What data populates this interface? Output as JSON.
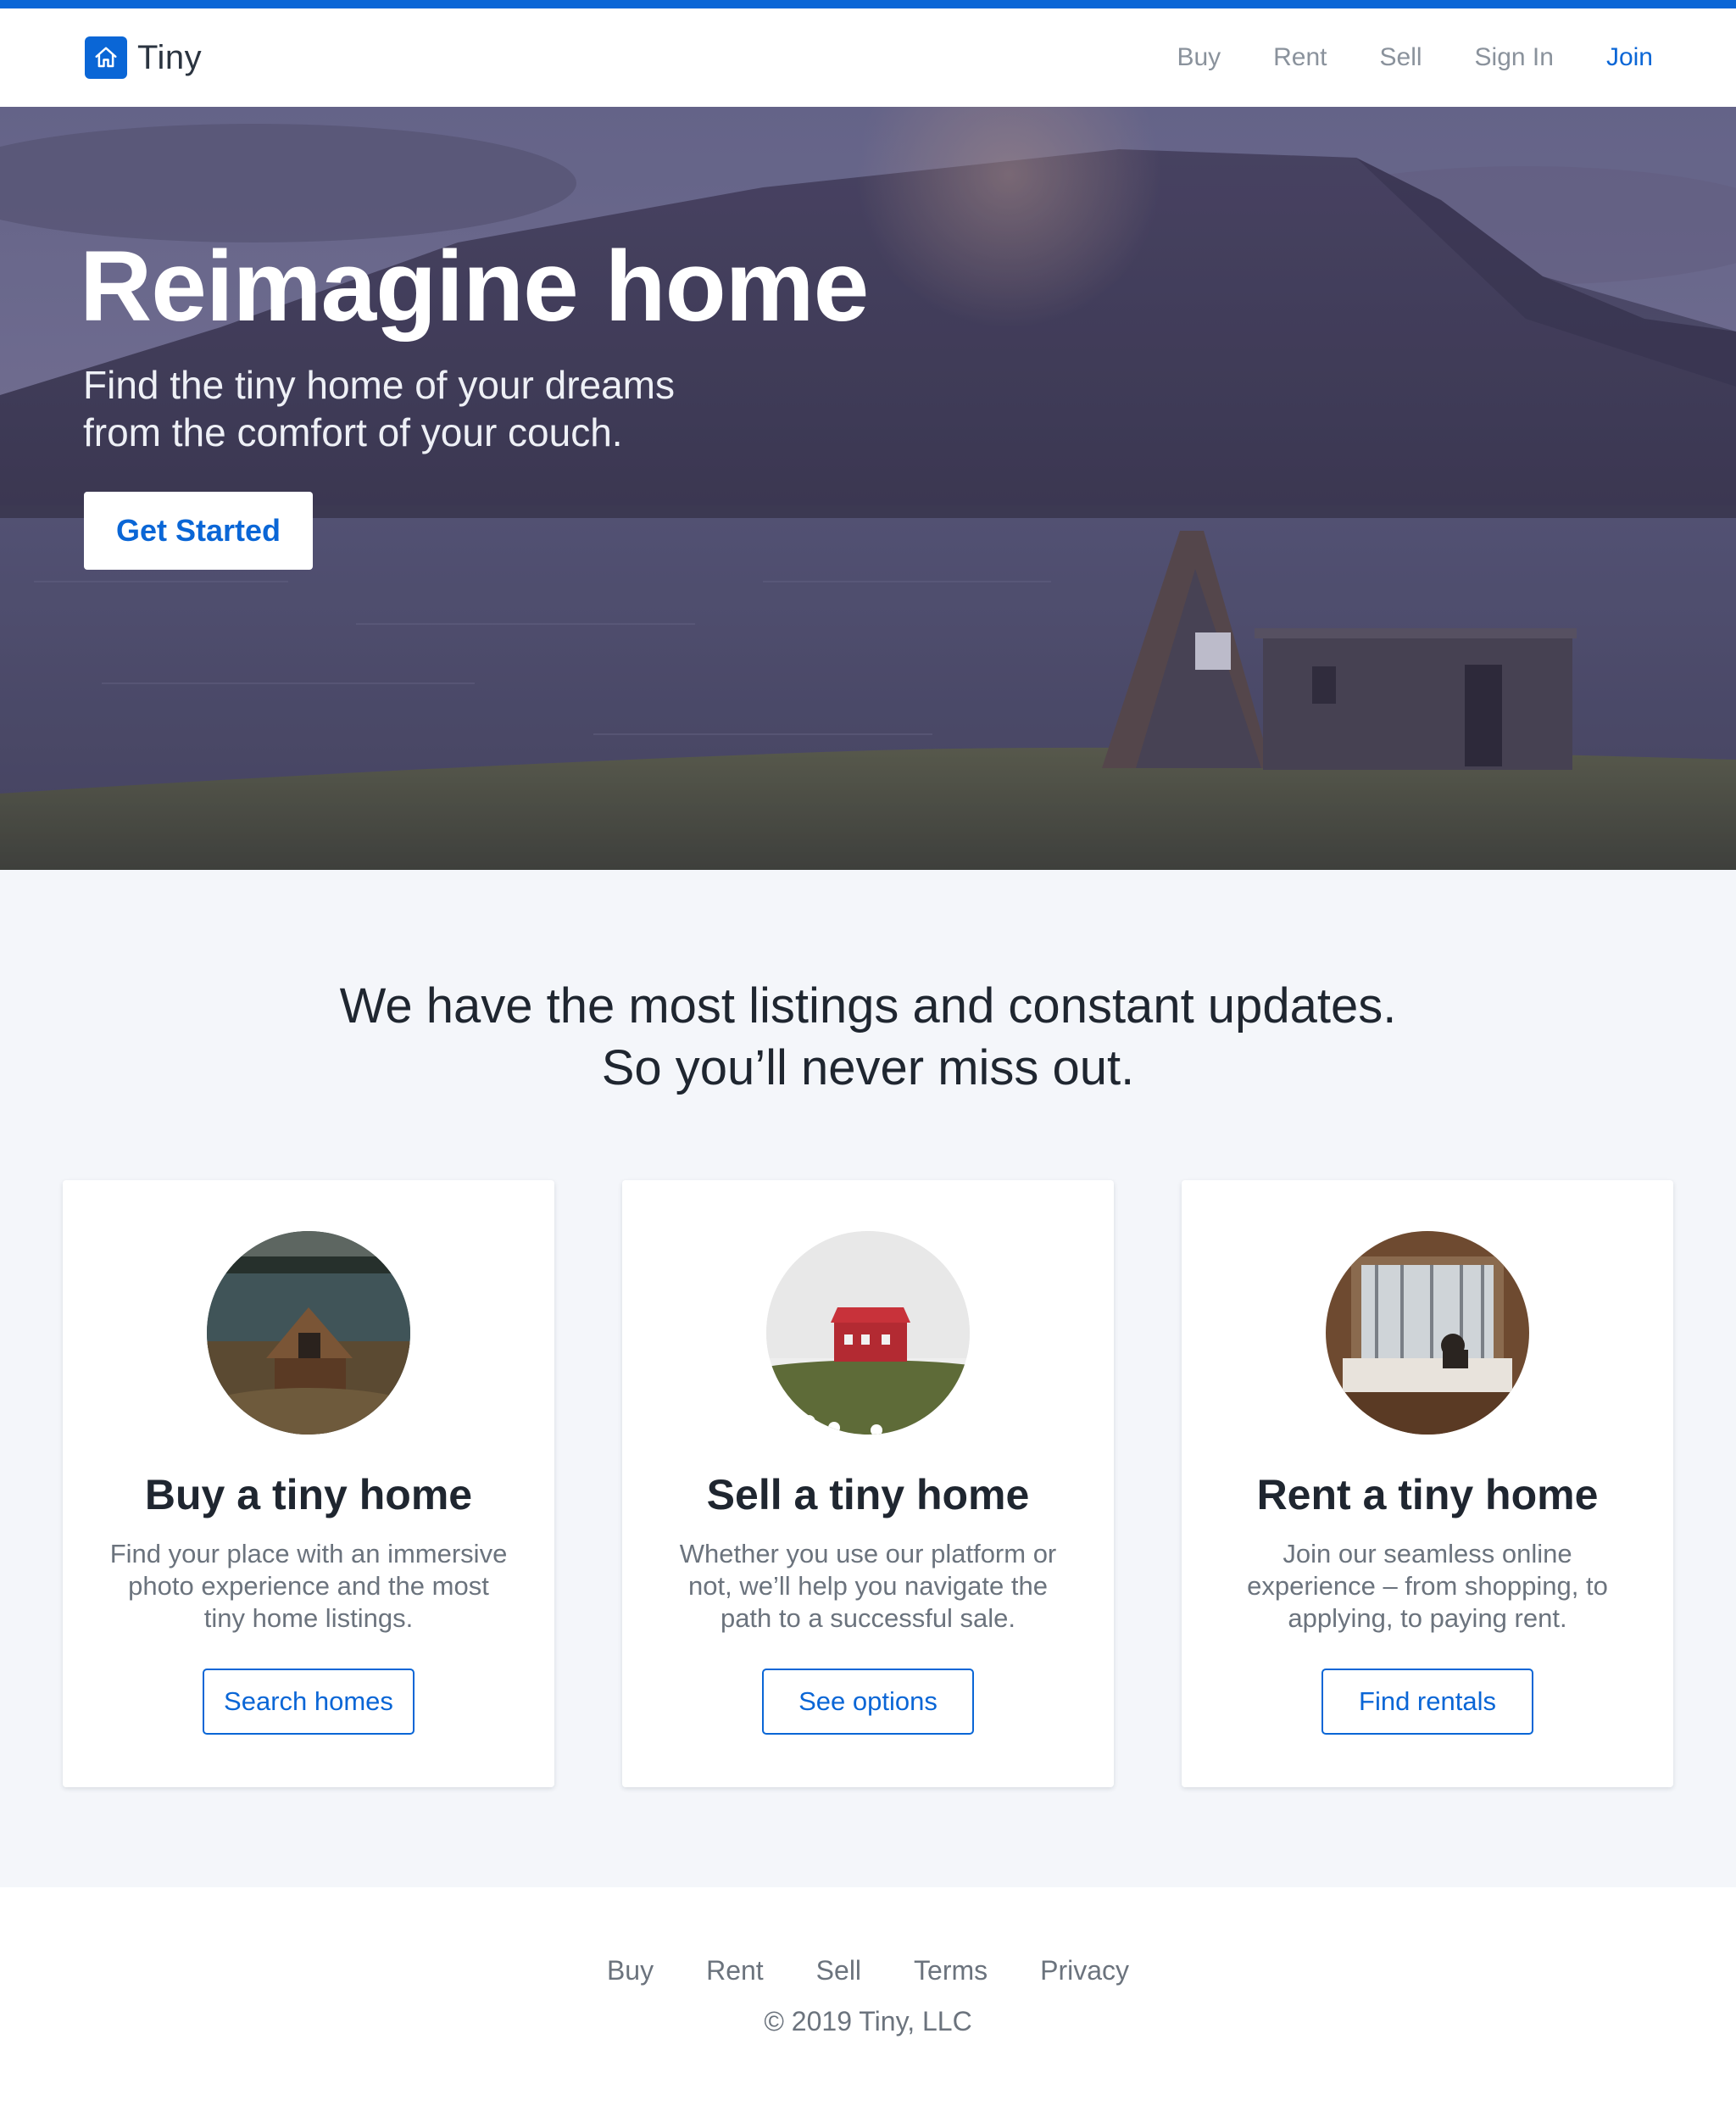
{
  "brand": {
    "name": "Tiny",
    "logo_icon": "house-icon",
    "accent_color": "#0a66d6"
  },
  "nav": {
    "items": [
      {
        "label": "Buy"
      },
      {
        "label": "Rent"
      },
      {
        "label": "Sell"
      },
      {
        "label": "Sign In"
      },
      {
        "label": "Join"
      }
    ]
  },
  "hero": {
    "title": "Reimagine home",
    "subtitle_line1": "Find the tiny home of your dreams",
    "subtitle_line2": "from the comfort of your couch.",
    "cta_label": "Get Started"
  },
  "tagline": {
    "line1": "We have the most listings and constant updates.",
    "line2": "So you’ll never miss out."
  },
  "cards": [
    {
      "title": "Buy a tiny home",
      "description": "Find your place with an immersive photo experience and the most tiny home listings.",
      "button_label": "Search homes"
    },
    {
      "title": "Sell a tiny home",
      "description": "Whether you use our platform or not, we’ll help you navigate the path to a successful sale.",
      "button_label": "See options"
    },
    {
      "title": "Rent a tiny home",
      "description": "Join our seamless online experience – from shopping, to applying, to paying rent.",
      "button_label": "Find rentals"
    }
  ],
  "footer": {
    "links": [
      {
        "label": "Buy"
      },
      {
        "label": "Rent"
      },
      {
        "label": "Sell"
      },
      {
        "label": "Terms"
      },
      {
        "label": "Privacy"
      }
    ],
    "copyright": "© 2019 Tiny, LLC"
  }
}
